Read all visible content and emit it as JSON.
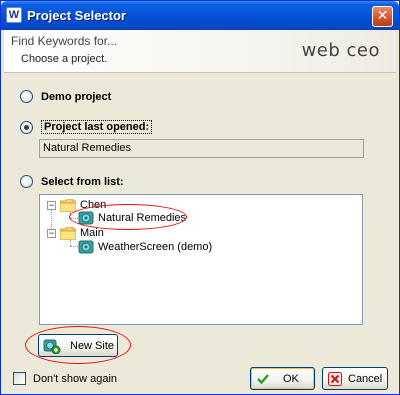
{
  "window": {
    "title": "Project Selector",
    "app_icon": "W",
    "close_icon": "✕"
  },
  "header": {
    "title": "Find Keywords for...",
    "subtitle": "Choose a project.",
    "logo": "web ceo"
  },
  "options": {
    "demo_label": "Demo project",
    "last_opened_label": "Project last opened:",
    "last_opened_value": "Natural Remedies",
    "select_list_label": "Select from list:"
  },
  "tree": {
    "groups": [
      {
        "name": "Chen",
        "expander": "−",
        "sites": [
          "Natural Remedies"
        ]
      },
      {
        "name": "Main",
        "expander": "−",
        "sites": [
          "WeatherScreen (demo)"
        ]
      }
    ]
  },
  "buttons": {
    "new_site": "New Site",
    "ok": "OK",
    "cancel": "Cancel"
  },
  "footer": {
    "dont_show_again": "Don't show again"
  },
  "colors": {
    "titlebar": "#0553d8",
    "annotation_red": "#e81010",
    "ok_check": "#21a121",
    "cancel_x": "#cc1111"
  }
}
